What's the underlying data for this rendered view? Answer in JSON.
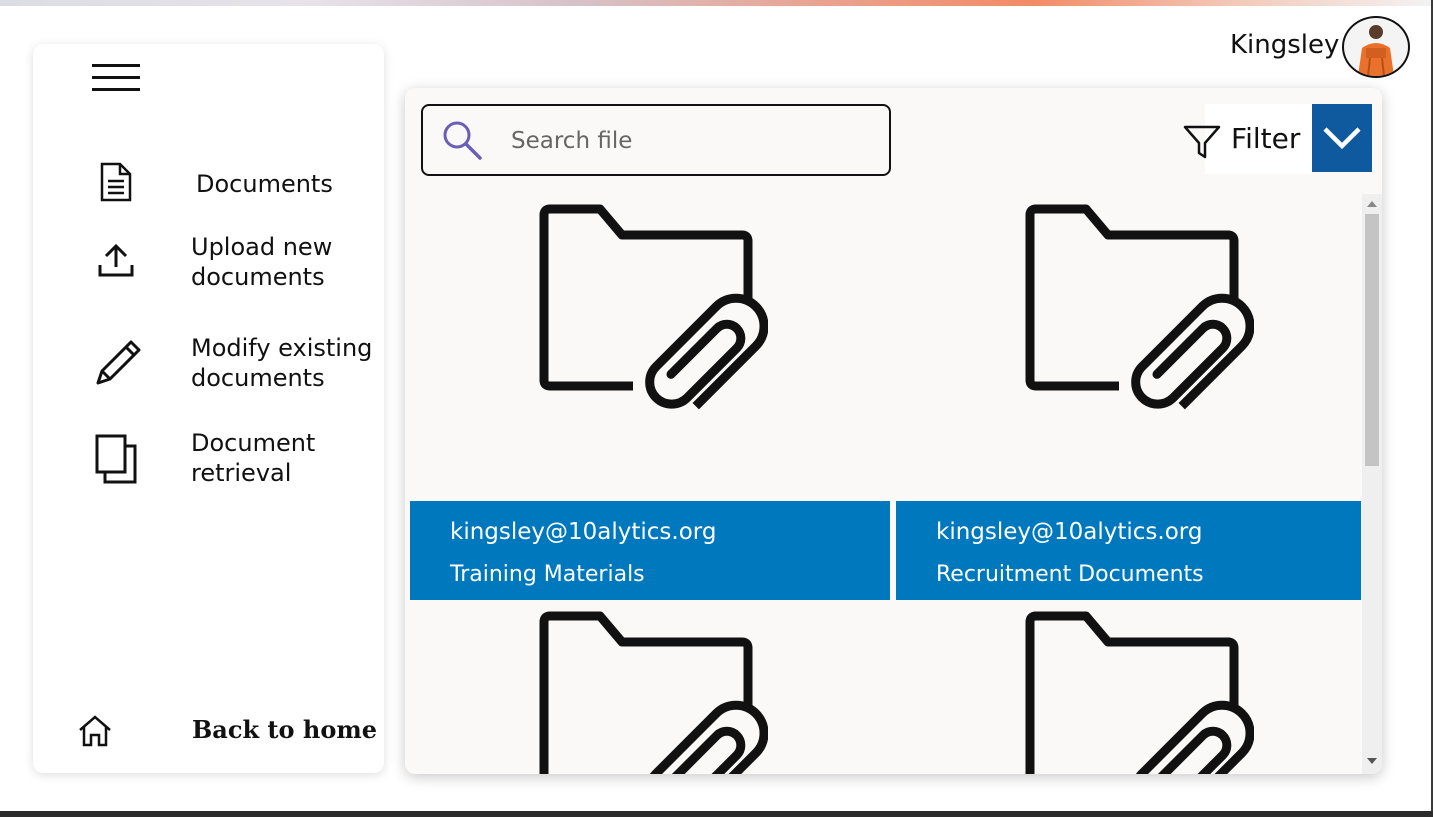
{
  "user": {
    "name": "Kingsley"
  },
  "sidebar": {
    "items": [
      {
        "label": "Documents",
        "icon": "document-icon"
      },
      {
        "label": "Upload new\ndocuments",
        "icon": "upload-icon"
      },
      {
        "label": "Modify existing\ndocuments",
        "icon": "pencil-icon"
      },
      {
        "label": "Document\nretrieval",
        "icon": "copy-icon"
      }
    ],
    "home": {
      "label": "Back to home",
      "icon": "home-icon"
    }
  },
  "search": {
    "placeholder": "Search file",
    "value": ""
  },
  "filter": {
    "label": "Filter"
  },
  "folders": [
    {
      "email": "kingsley@10alytics.org",
      "name": "Training Materials"
    },
    {
      "email": "kingsley@10alytics.org",
      "name": "Recruitment Documents"
    },
    {
      "email": "",
      "name": ""
    },
    {
      "email": "",
      "name": ""
    }
  ],
  "colors": {
    "caption_bg": "#0078be",
    "dropdown_bg": "#0f5a9e",
    "search_icon": "#6b5fb5"
  }
}
